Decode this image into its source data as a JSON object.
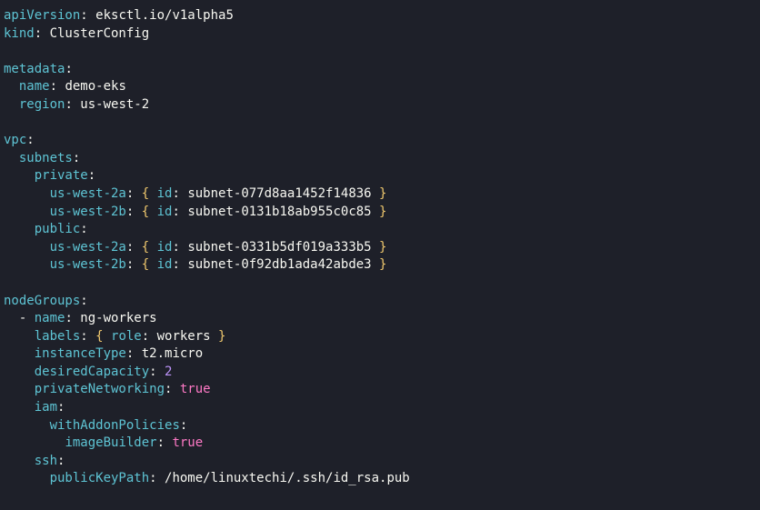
{
  "yaml": {
    "apiVersion": {
      "k": "apiVersion",
      "v": "eksctl.io/v1alpha5"
    },
    "kind": {
      "k": "kind",
      "v": "ClusterConfig"
    },
    "metadata": {
      "k": "metadata",
      "name": {
        "k": "name",
        "v": "demo-eks"
      },
      "region": {
        "k": "region",
        "v": "us-west-2"
      }
    },
    "vpc": {
      "k": "vpc",
      "subnets": {
        "k": "subnets",
        "private": {
          "k": "private",
          "a": {
            "k": "us-west-2a",
            "idk": "id",
            "idv": "subnet-077d8aa1452f14836"
          },
          "b": {
            "k": "us-west-2b",
            "idk": "id",
            "idv": "subnet-0131b18ab955c0c85"
          }
        },
        "public": {
          "k": "public",
          "a": {
            "k": "us-west-2a",
            "idk": "id",
            "idv": "subnet-0331b5df019a333b5"
          },
          "b": {
            "k": "us-west-2b",
            "idk": "id",
            "idv": "subnet-0f92db1ada42abde3"
          }
        }
      }
    },
    "nodeGroups": {
      "k": "nodeGroups",
      "item": {
        "dash": "- ",
        "name": {
          "k": "name",
          "v": "ng-workers"
        },
        "labels": {
          "k": "labels",
          "rolek": "role",
          "rolev": "workers"
        },
        "instanceType": {
          "k": "instanceType",
          "v": "t2.micro"
        },
        "desiredCapacity": {
          "k": "desiredCapacity",
          "v": "2"
        },
        "privateNetworking": {
          "k": "privateNetworking",
          "v": "true"
        },
        "iam": {
          "k": "iam",
          "withAddonPolicies": {
            "k": "withAddonPolicies",
            "imageBuilder": {
              "k": "imageBuilder",
              "v": "true"
            }
          }
        },
        "ssh": {
          "k": "ssh",
          "publicKeyPath": {
            "k": "publicKeyPath",
            "v": "/home/linuxtechi/.ssh/id_rsa.pub"
          }
        }
      }
    }
  },
  "punct": {
    "colon": ":",
    "colonsp": ": ",
    "lbrace": "{ ",
    "rbrace": " }"
  }
}
